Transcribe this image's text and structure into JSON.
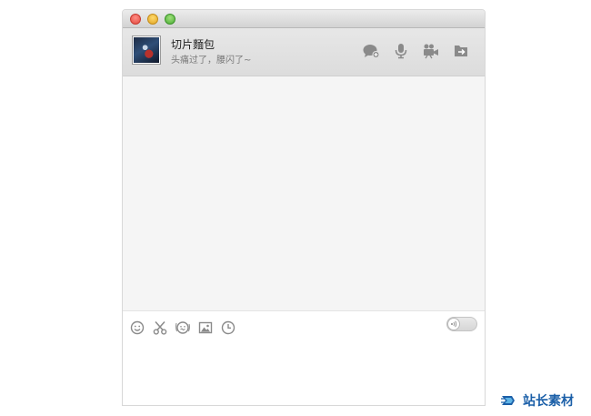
{
  "window": {
    "traffic_lights": [
      "close",
      "minimize",
      "zoom"
    ]
  },
  "chat_header": {
    "contact_name": "切片麵包",
    "contact_status": "头痛过了，腰闪了~",
    "actions": [
      {
        "name": "chat-bubble-add",
        "icon": "chat-bubble-plus-icon"
      },
      {
        "name": "voice-call",
        "icon": "microphone-icon"
      },
      {
        "name": "video-call",
        "icon": "video-camera-icon"
      },
      {
        "name": "send-file",
        "icon": "folder-arrow-icon"
      }
    ]
  },
  "input_toolbar": {
    "tools": [
      {
        "name": "emoji",
        "icon": "smiley-icon"
      },
      {
        "name": "screenshot",
        "icon": "scissors-icon"
      },
      {
        "name": "shake",
        "icon": "shake-icon"
      },
      {
        "name": "image",
        "icon": "image-icon"
      },
      {
        "name": "history",
        "icon": "clock-icon"
      }
    ],
    "voice_toggle": {
      "icon": "sound-wave-icon",
      "on": false
    }
  },
  "input": {
    "value": ""
  },
  "watermark": {
    "text": "站长素材"
  },
  "colors": {
    "icon_gray": "#8a8a8a",
    "header_bg": "#e2e2e2",
    "message_bg": "#f5f5f5",
    "watermark_blue": "#1b5fa8"
  }
}
